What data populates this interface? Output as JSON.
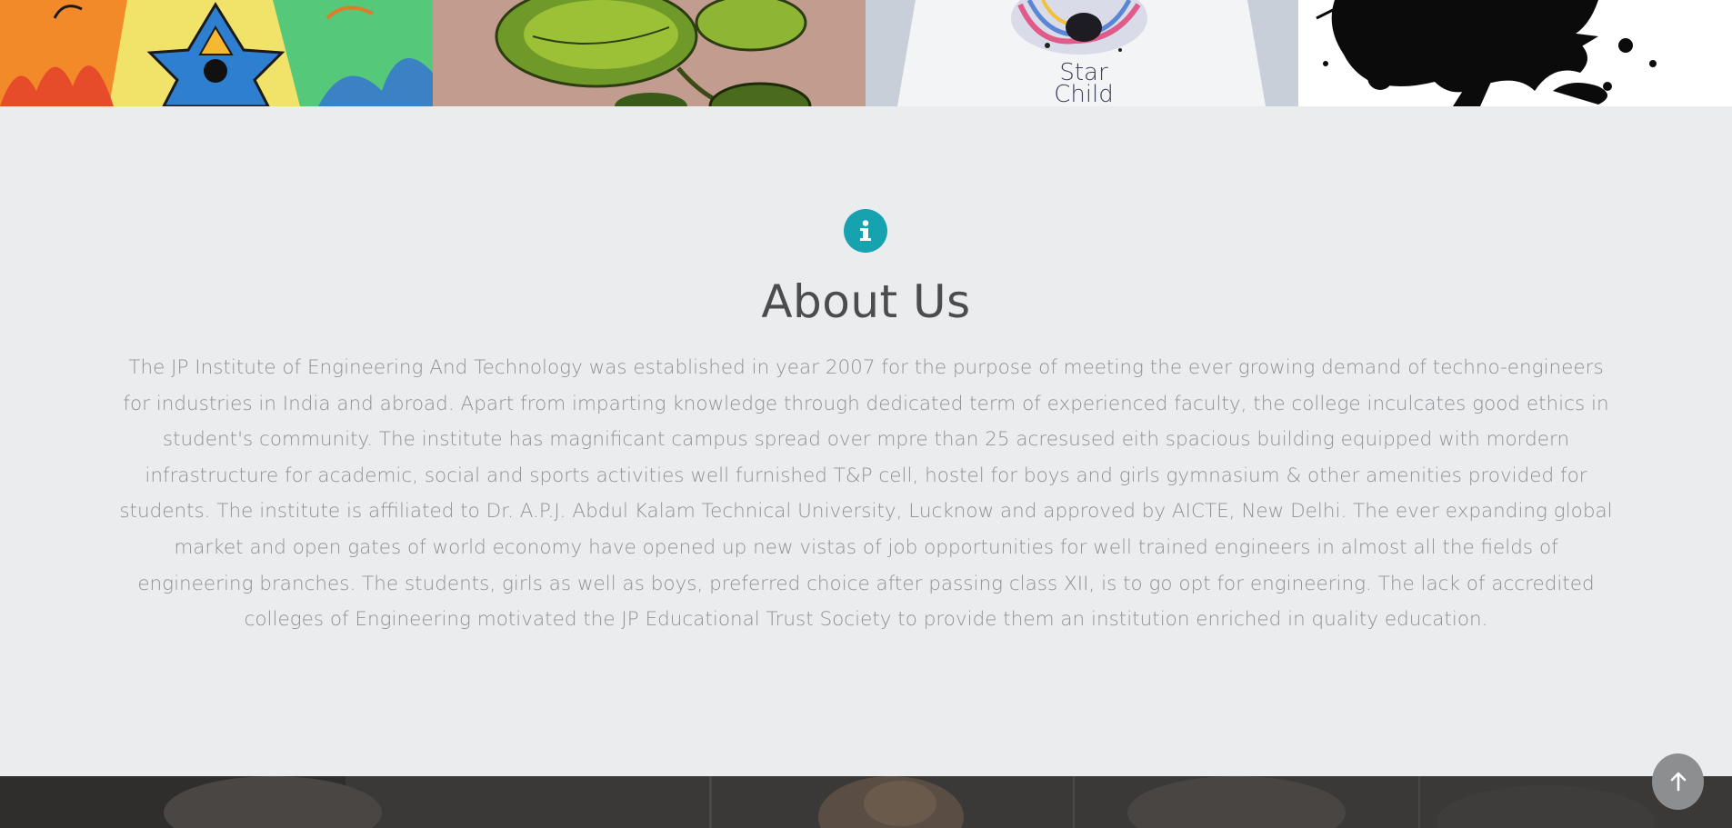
{
  "gallery": {
    "tiles": [
      {
        "icon": "artwork-star-image",
        "caption": ""
      },
      {
        "icon": "leaf-painting-image",
        "caption": ""
      },
      {
        "icon": "tshirt-print-image",
        "caption": "Star Child"
      },
      {
        "icon": "ink-splash-image",
        "caption": ""
      }
    ]
  },
  "about": {
    "icon": "info-icon",
    "title": "About Us",
    "body": "The JP Institute of Engineering And Technology was established in year 2007 for the purpose of meeting the ever growing demand of techno-engineers for industries in India and abroad. Apart from imparting knowledge through dedicated term of experienced faculty, the college inculcates good ethics in student's community. The institute has magnificant campus spread over mpre than 25 acresused eith spacious building equipped with mordern infrastructure for academic, social and sports activities well furnished T&P cell, hostel for boys and girls gymnasium & other amenities provided for students. The institute is affiliated to Dr. A.P.J. Abdul Kalam Technical University, Lucknow and approved by AICTE, New Delhi. The ever expanding global market and open gates of world economy have opened up new vistas of job opportunities for well trained engineers in almost all the fields of engineering branches. The students, girls as well as boys, preferred choice after passing class XII, is to go opt for engineering. The lack of accredited colleges of Engineering motivated the JP Educational Trust Society to provide them an institution enriched in quality education."
  },
  "back_to_top": {
    "icon": "arrow-up-icon"
  },
  "colors": {
    "accent": "#17a2b0",
    "background": "#ebecee",
    "title": "#4a4d50",
    "text": "#8f9296",
    "button": "#8d8e90"
  }
}
